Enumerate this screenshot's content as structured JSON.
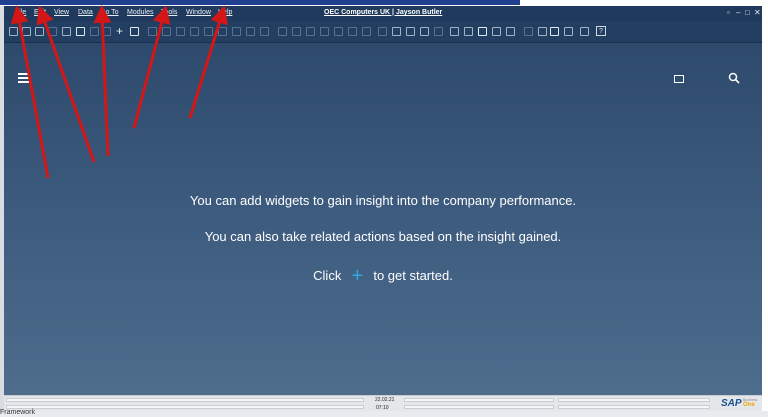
{
  "window": {
    "title": "OEC Computers UK | Jayson Butler",
    "controls": [
      "▫",
      "–",
      "□",
      "✕"
    ]
  },
  "menu": {
    "items": [
      "File",
      "Edit",
      "View",
      "Data",
      "Go To",
      "Modules",
      "Tools",
      "Window",
      "Help"
    ]
  },
  "toolbar": {
    "help_label": "?"
  },
  "content": {
    "message_line1": "You can add widgets to gain insight into the company performance.",
    "message_line2": "You can also take related actions based on the insight gained.",
    "message_click": "Click",
    "message_suffix": "to get started.",
    "plus_glyph": "+"
  },
  "statusbar": {
    "date": "22.02.21",
    "time": "07:10"
  },
  "branding": {
    "logo_main": "SAP",
    "logo_sub": "Business",
    "logo_one": "One"
  },
  "background": {
    "behind_label": "Framework"
  },
  "colors": {
    "accent_plus": "#31a6e0",
    "annotation_arrows": "#d51616",
    "content_bg": "#3c5a7d"
  }
}
